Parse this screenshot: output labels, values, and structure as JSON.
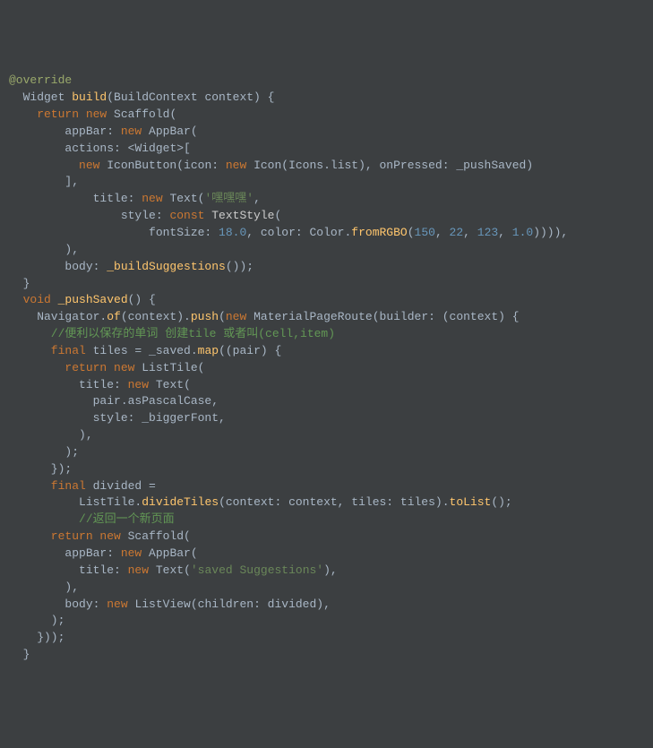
{
  "code": {
    "l1_annotation": "@override",
    "l2_a": "  Widget ",
    "l2_b": "build",
    "l2_c": "(BuildContext context) {",
    "l3_a": "    return new ",
    "l3_b": "Scaffold",
    "l3_c": "(",
    "l4_a": "        appBar: ",
    "l4_b": "new ",
    "l4_c": "AppBar",
    "l4_d": "(",
    "l5_a": "        actions: <",
    "l5_b": "Widget",
    "l5_c": ">[",
    "l6_a": "          new ",
    "l6_b": "IconButton",
    "l6_c": "(icon: ",
    "l6_d": "new ",
    "l6_e": "Icon",
    "l6_f": "(Icons.list), onPressed: _pushSaved)",
    "l7": "        ],",
    "l8_a": "            title: ",
    "l8_b": "new ",
    "l8_c": "Text",
    "l8_d": "(",
    "l8_e": "'嘿嘿嘿'",
    "l8_f": ",",
    "l9_a": "                style: ",
    "l9_b": "const ",
    "l9_c": "TextStyle",
    "l9_d": "(",
    "l10_a": "                    fontSize: ",
    "l10_b": "18.0",
    "l10_c": ", color: Color.",
    "l10_d": "fromRGBO",
    "l10_e": "(",
    "l10_f": "150",
    "l10_g": ", ",
    "l10_h": "22",
    "l10_i": ", ",
    "l10_j": "123",
    "l10_k": ", ",
    "l10_l": "1.0",
    "l10_m": ")))),",
    "l11": "        ),",
    "l12_a": "        body: ",
    "l12_b": "_buildSuggestions",
    "l12_c": "());",
    "l13": "  }",
    "l14_a": "  void ",
    "l14_b": "_pushSaved",
    "l14_c": "() {",
    "l15_a": "    Navigator.",
    "l15_b": "of",
    "l15_c": "(context).",
    "l15_d": "push",
    "l15_e": "(",
    "l15_f": "new ",
    "l15_g": "MaterialPageRoute",
    "l15_h": "(builder: (context) {",
    "l16": "      //便利以保存的单词 创建tile 或者叫(cell,item)",
    "l17_a": "      final ",
    "l17_b": "tiles = _saved.",
    "l17_c": "map",
    "l17_d": "((pair) {",
    "l18_a": "        return new ",
    "l18_b": "ListTile",
    "l18_c": "(",
    "l19_a": "          title: ",
    "l19_b": "new ",
    "l19_c": "Text",
    "l19_d": "(",
    "l20": "            pair.asPascalCase,",
    "l21": "            style: _biggerFont,",
    "l22": "          ),",
    "l23": "        );",
    "l24": "      });",
    "l25_a": "      final ",
    "l25_b": "divided =",
    "l26_a": "          ListTile.",
    "l26_b": "divideTiles",
    "l26_c": "(context: context, tiles: tiles).",
    "l26_d": "toList",
    "l26_e": "();",
    "l27": "          //返回一个新页面",
    "l28_a": "      return new ",
    "l28_b": "Scaffold",
    "l28_c": "(",
    "l29_a": "        appBar: ",
    "l29_b": "new ",
    "l29_c": "AppBar",
    "l29_d": "(",
    "l30_a": "          title: ",
    "l30_b": "new ",
    "l30_c": "Text",
    "l30_d": "(",
    "l30_e": "'saved Suggestions'",
    "l30_f": "),",
    "l31": "        ),",
    "l32_a": "        body: ",
    "l32_b": "new ",
    "l32_c": "ListView",
    "l32_d": "(children: divided),",
    "l33": "      );",
    "l34": "    }));",
    "l35": "  }"
  }
}
